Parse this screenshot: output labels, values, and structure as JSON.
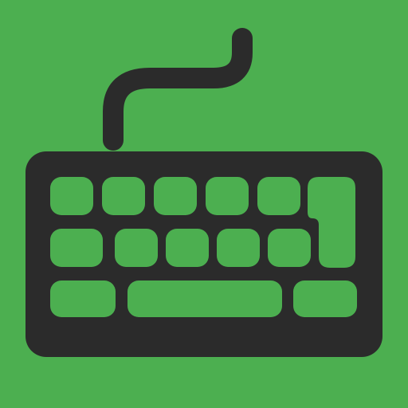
{
  "app_icon": {
    "icon_name": "keyboard-icon",
    "colors": {
      "background": "#4caf50",
      "foreground": "#2b2b2b"
    },
    "keyboard": {
      "rows": [
        {
          "row": 1,
          "key_count": 5,
          "has_enter_key": true
        },
        {
          "row": 2,
          "key_count": 5,
          "has_enter_key": true
        },
        {
          "row": 3,
          "key_count": 3,
          "has_space_bar": true
        }
      ]
    }
  }
}
